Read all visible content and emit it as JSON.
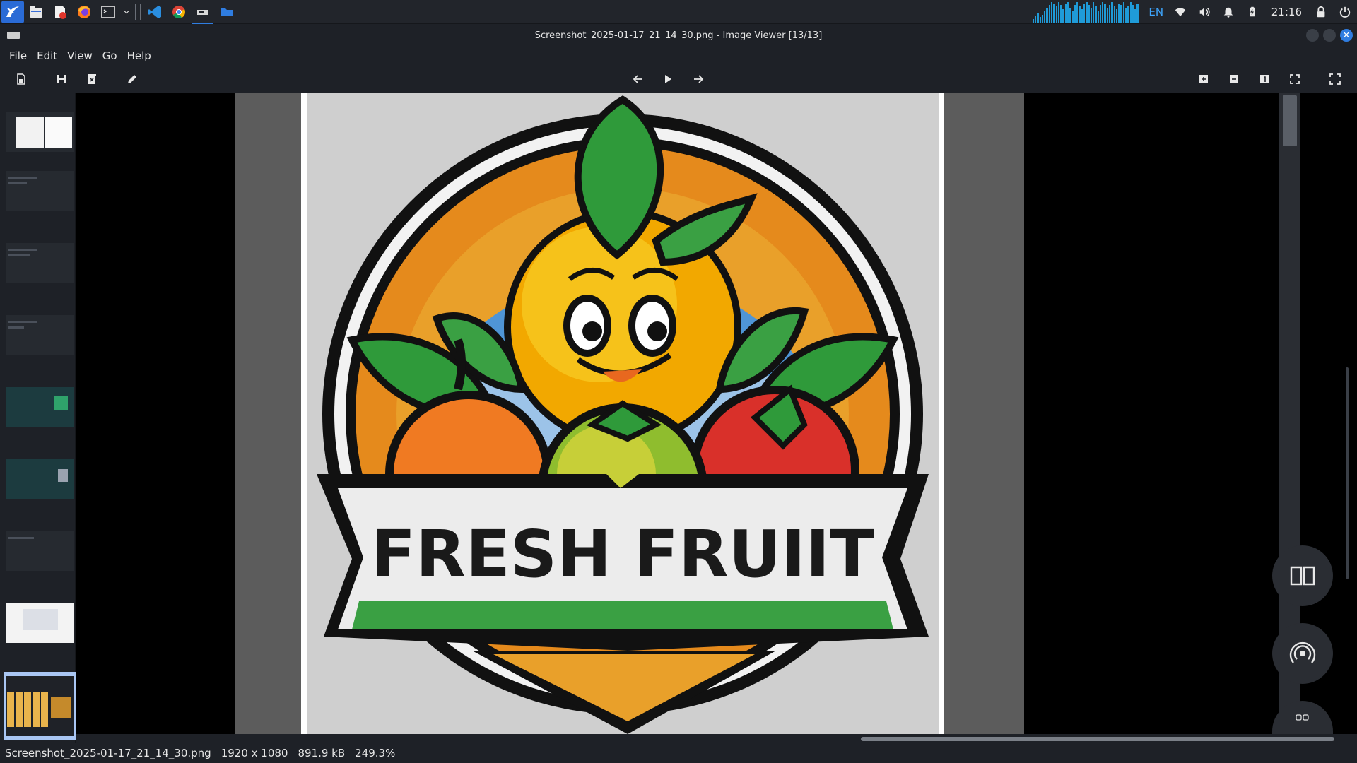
{
  "panel": {
    "apps": [
      "launcher-icon",
      "file-manager-icon",
      "pdf-editor-icon",
      "firefox-icon",
      "terminal-icon",
      "vscode-icon",
      "chrome-icon",
      "image-viewer-icon",
      "folder-icon"
    ],
    "lang": "EN",
    "clock": "21:16",
    "accent": "#1f9bd8"
  },
  "window": {
    "title": "Screenshot_2025-01-17_21_14_30.png - Image Viewer [13/13]",
    "close_glyph": "✕"
  },
  "menu": {
    "items": [
      "File",
      "Edit",
      "View",
      "Go",
      "Help"
    ]
  },
  "toolbar": {
    "left": [
      "open-icon",
      "save-icon",
      "delete-icon",
      "edit-icon"
    ],
    "center": [
      "previous-icon",
      "slideshow-icon",
      "next-icon"
    ],
    "right": [
      "zoom-in-icon",
      "zoom-out-icon",
      "actual-size-icon",
      "fit-window-icon",
      "fullscreen-icon"
    ]
  },
  "image": {
    "banner_text": "FRESH FRUIIT"
  },
  "status": {
    "filename": "Screenshot_2025-01-17_21_14_30.png",
    "dimensions": "1920 x 1080",
    "filesize": "891.9 kB",
    "zoom": "249.3%"
  },
  "colors": {
    "selection": "#a9c6f3",
    "brand": "#2f7de1"
  }
}
